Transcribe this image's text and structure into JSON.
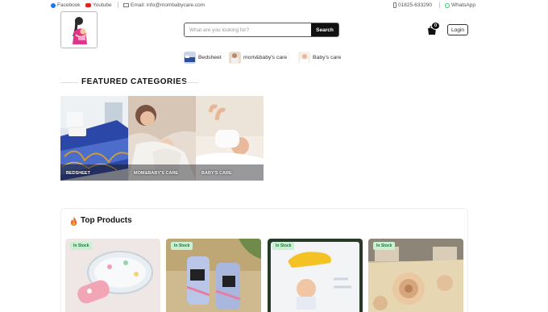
{
  "topbar": {
    "facebook": "Facebook",
    "youtube": "Youtube",
    "email": "Email: info@mombabycare.com",
    "phone": "01825-633290",
    "whatsapp": "WhatsApp"
  },
  "search": {
    "placeholder": "What are you looking for?",
    "button": "Search"
  },
  "cart": {
    "count": "0"
  },
  "login_label": "Login",
  "quick_links": [
    "Bedsheet",
    "mom&baby's care",
    "Baby's care"
  ],
  "featured": {
    "title": "FEATURED CATEGORIES",
    "categories": [
      "BEDSHEET",
      "MOM&BABY'S CARE",
      "BABY'S CARE"
    ]
  },
  "top_products": {
    "title": "Top Products",
    "badge": "In Stock"
  },
  "colors": {
    "accent": "#111111",
    "stock_bg": "#c9f0d2",
    "stock_text": "#187a34"
  }
}
